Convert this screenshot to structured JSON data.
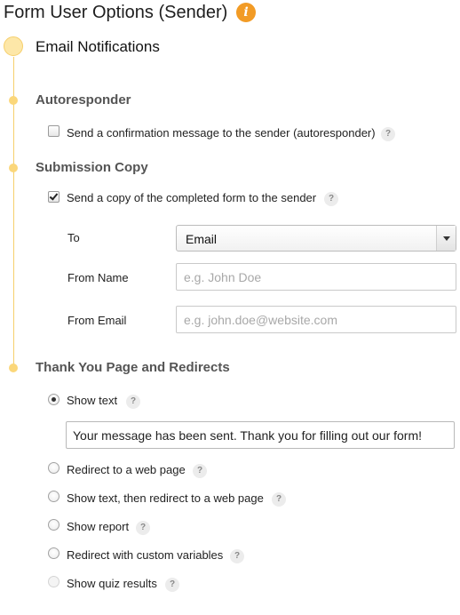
{
  "header": {
    "title": "Form User Options (Sender)",
    "info_icon": "i"
  },
  "section": {
    "title": "Email Notifications"
  },
  "autoresponder": {
    "heading": "Autoresponder",
    "checkbox_label": "Send a confirmation message to the sender (autoresponder)",
    "checked": false,
    "help": "?"
  },
  "submission_copy": {
    "heading": "Submission Copy",
    "checkbox_label": "Send a copy of the completed form to the sender",
    "checked": true,
    "help": "?",
    "to": {
      "label": "To",
      "value": "Email"
    },
    "from_name": {
      "label": "From Name",
      "value": "",
      "placeholder": "e.g. John Doe"
    },
    "from_email": {
      "label": "From Email",
      "value": "",
      "placeholder": "e.g. john.doe@website.com"
    }
  },
  "thank_you": {
    "heading": "Thank You Page and Redirects",
    "message": "Your message has been sent. Thank you for filling out our form!",
    "options": [
      {
        "label": "Show text",
        "help": "?",
        "selected": true
      },
      {
        "label": "Redirect to a web page",
        "help": "?",
        "selected": false
      },
      {
        "label": "Show text, then redirect to a web page",
        "help": "?",
        "selected": false
      },
      {
        "label": "Show report",
        "help": "?",
        "selected": false
      },
      {
        "label": "Redirect with custom variables",
        "help": "?",
        "selected": false
      },
      {
        "label": "Show quiz results",
        "help": "?",
        "selected": false,
        "disabled": true
      }
    ]
  },
  "colors": {
    "accent": "#f29b25",
    "timeline": "#f6cf6c",
    "heading_gray": "#555555"
  }
}
